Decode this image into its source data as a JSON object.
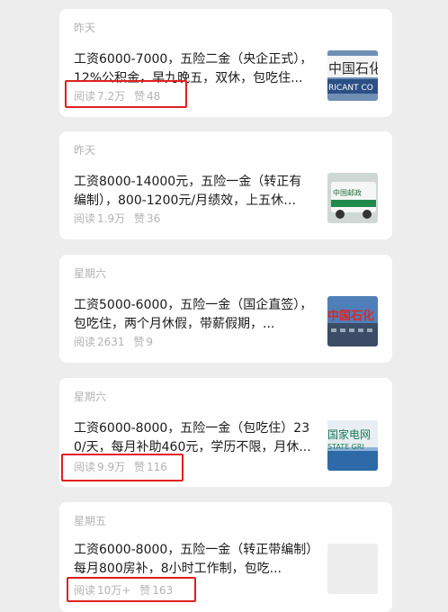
{
  "feed": {
    "items": [
      {
        "date": "昨天",
        "title": "工资6000-7000，五险二金（央企正式），12%公积金，早九晚五，双休，包吃住...",
        "read_label": "阅读",
        "read_count": "7.2万",
        "like_label": "赞",
        "like_count": "48",
        "thumb_icon": "sinopec-sign-thumbnail",
        "thumb_text_top": "中国石化",
        "thumb_text_bottom": "RICANT CO",
        "highlighted": true
      },
      {
        "date": "昨天",
        "title": "工资8000-14000元，五险一金（转正有编制），800-1200元/月绩效，上五休二，...",
        "read_label": "阅读",
        "read_count": "1.9万",
        "like_label": "赞",
        "like_count": "36",
        "thumb_icon": "china-post-van-thumbnail",
        "thumb_text_top": "中国邮政",
        "highlighted": false
      },
      {
        "date": "星期六",
        "title": "工资5000-6000，五险一金（国企直签），包吃住，两个月休假，带薪假期，...",
        "read_label": "阅读",
        "read_count": "2631",
        "like_label": "赞",
        "like_count": "9",
        "thumb_icon": "sinopec-building-thumbnail",
        "thumb_text_top": "中国石化",
        "highlighted": false
      },
      {
        "date": "星期六",
        "title": "工资6000-8000，五险一金（包吃住）230/天，每月补助460元，学历不限，月休...",
        "read_label": "阅读",
        "read_count": "9.9万",
        "like_label": "赞",
        "like_count": "116",
        "thumb_icon": "state-grid-building-thumbnail",
        "thumb_text_top": "国家电网",
        "thumb_text_bottom": "STATE GRI",
        "highlighted": true
      },
      {
        "date": "星期五",
        "title": "工资6000-8000，五险一金（转正带编制）每月800房补，8小时工作制，包吃...",
        "read_label": "阅读",
        "read_count": "10万+",
        "like_label": "赞",
        "like_count": "163",
        "thumb_icon": "blank-thumbnail",
        "highlighted": true
      }
    ]
  },
  "colors": {
    "background": "#ededed",
    "card": "#ffffff",
    "highlight": "#e02020",
    "meta_text": "#b2b2b2",
    "title_text": "#1a1a1a"
  }
}
